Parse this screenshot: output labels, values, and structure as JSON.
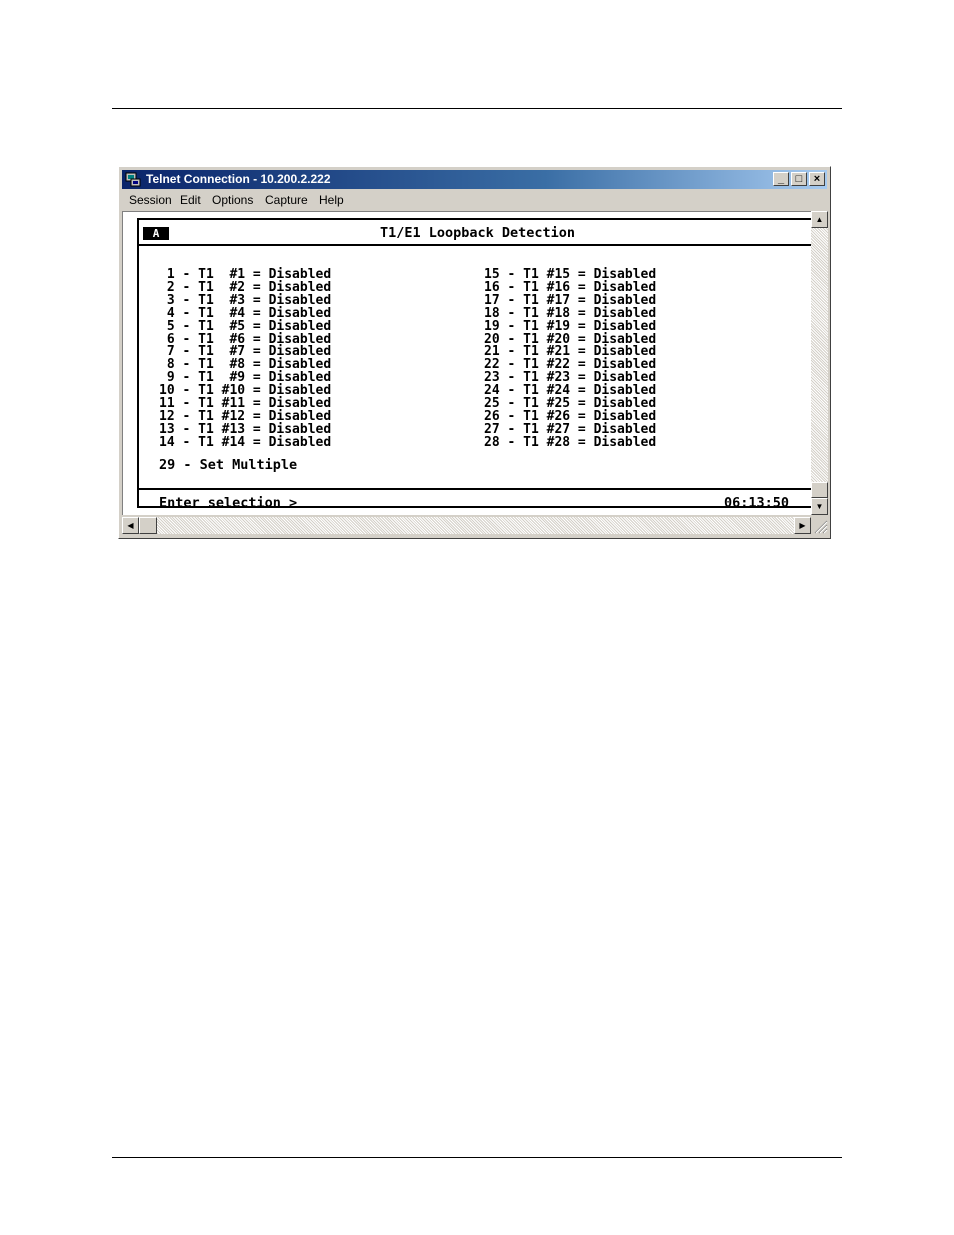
{
  "window": {
    "title": "Telnet Connection - 10.200.2.222",
    "controls": {
      "minimize": "_",
      "maximize": "□",
      "close": "×"
    }
  },
  "menu": [
    "Session",
    "Edit",
    "Options",
    "Capture",
    "Help"
  ],
  "terminal": {
    "badge": "A",
    "title": "T1/E1 Loopback Detection",
    "left_rows": [
      " 1 - T1  #1 = Disabled",
      " 2 - T1  #2 = Disabled",
      " 3 - T1  #3 = Disabled",
      " 4 - T1  #4 = Disabled",
      " 5 - T1  #5 = Disabled",
      " 6 - T1  #6 = Disabled",
      " 7 - T1  #7 = Disabled",
      " 8 - T1  #8 = Disabled",
      " 9 - T1  #9 = Disabled",
      "10 - T1 #10 = Disabled",
      "11 - T1 #11 = Disabled",
      "12 - T1 #12 = Disabled",
      "13 - T1 #13 = Disabled",
      "14 - T1 #14 = Disabled"
    ],
    "right_rows": [
      "15 - T1 #15 = Disabled",
      "16 - T1 #16 = Disabled",
      "17 - T1 #17 = Disabled",
      "18 - T1 #18 = Disabled",
      "19 - T1 #19 = Disabled",
      "20 - T1 #20 = Disabled",
      "21 - T1 #21 = Disabled",
      "22 - T1 #22 = Disabled",
      "23 - T1 #23 = Disabled",
      "24 - T1 #24 = Disabled",
      "25 - T1 #25 = Disabled",
      "26 - T1 #26 = Disabled",
      "27 - T1 #27 = Disabled",
      "28 - T1 #28 = Disabled"
    ],
    "set_multiple": "29 - Set Multiple",
    "prompt": "Enter selection >",
    "clock": "06:13:50"
  },
  "scroll": {
    "up": "▲",
    "down": "▼",
    "left": "◀",
    "right": "▶"
  }
}
